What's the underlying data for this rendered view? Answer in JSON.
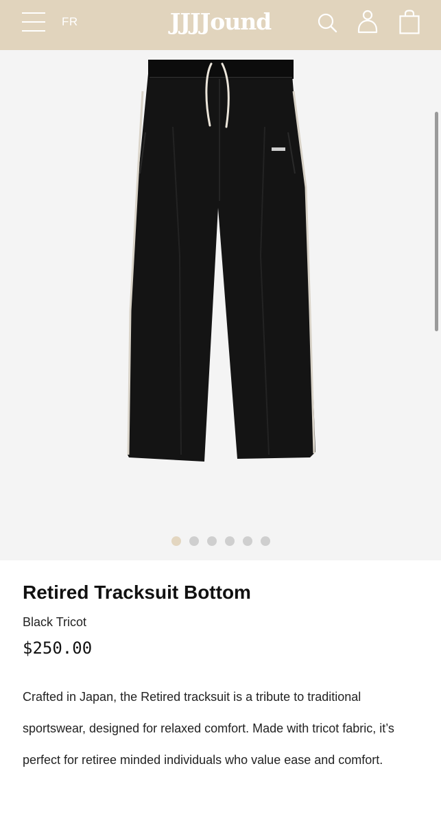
{
  "header": {
    "language": "FR",
    "logo": "JJJJound",
    "icons": [
      "menu-icon",
      "search-icon",
      "account-icon",
      "shopping-bag-icon"
    ],
    "background": "#e1d4bd"
  },
  "gallery": {
    "image_subject": "Black tracksuit pants",
    "slide_count": 6,
    "active_slide": 1,
    "active_dot_color": "#e3d6c0",
    "dot_color": "#cfcfcf",
    "background": "#f4f4f4"
  },
  "product": {
    "title": "Retired Tracksuit Bottom",
    "variant": "Black Tricot",
    "price": "$250.00",
    "description": "Crafted in Japan, the Retired tracksuit is a tribute to traditional sportswear, designed for relaxed comfort. Made with tricot fabric, it’s perfect for retiree minded individuals who value ease and comfort."
  }
}
